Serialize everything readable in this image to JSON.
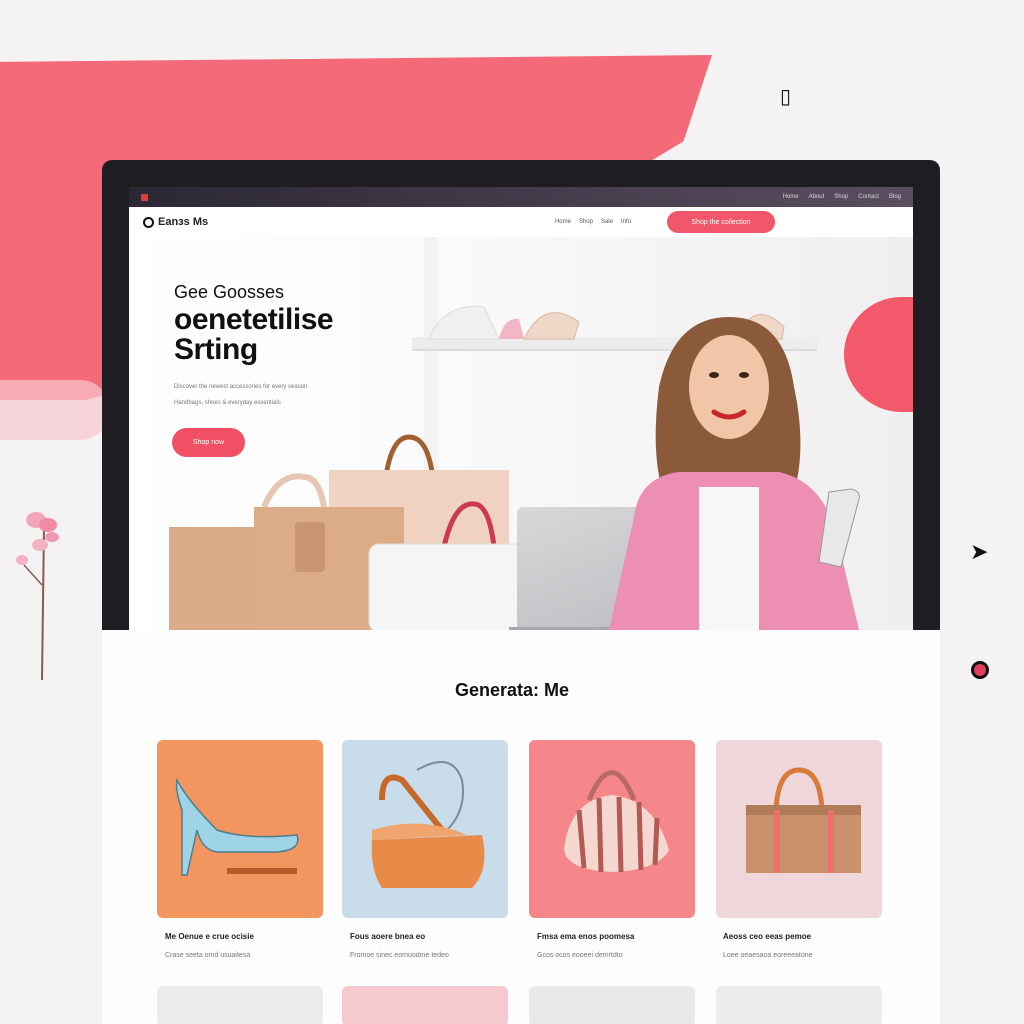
{
  "topbar": {
    "links": [
      "Home",
      "About",
      "Shop",
      "Contact",
      "Blog"
    ]
  },
  "navbar": {
    "brand": "Eanɜs Ms",
    "links": [
      "Home",
      "Shop",
      "Sale",
      "Info"
    ],
    "cta_label": "Shop the collection"
  },
  "hero": {
    "kicker": "Gee Goosses",
    "title_line1": "oenetetilise",
    "title_line2": "Srting",
    "body_line1": "Discover the newest accessories for every season",
    "body_line2": "Handbags, shoes & everyday essentials",
    "button_label": "Shop now"
  },
  "products": {
    "section_title": "Generata: Me",
    "items": [
      {
        "title": "Me Oenue e crue ocisie",
        "subtitle": "Crase seeta omd usuaitesa",
        "bg": "#f2955e"
      },
      {
        "title": "Fous aoere bnea eo",
        "subtitle": "Fromoe sinec eomuodme tedeo",
        "bg": "#c9dcea"
      },
      {
        "title": "Fmsa ema enos poomesa",
        "subtitle": "Gcos ocos eooeei demrtdto",
        "bg": "#f5878a"
      },
      {
        "title": "Aeoss ceo eeas pemoe",
        "subtitle": "Loee oeaesaoa eoreeeatone",
        "bg": "#eed6da"
      }
    ]
  },
  "colors": {
    "accent": "#f2566a",
    "stripe": "#f46a78"
  }
}
